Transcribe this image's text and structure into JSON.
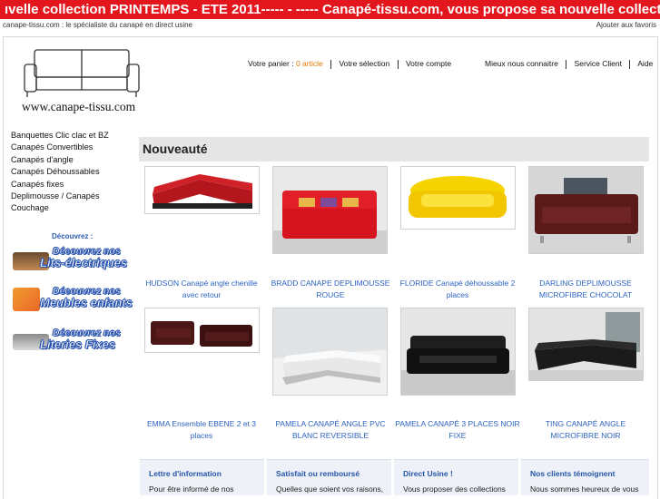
{
  "banner": {
    "text": "ıvelle collection PRINTEMPS - ETE 2011----- - ----- Canapé-tissu.com, vous propose sa nouvelle collecti"
  },
  "header": {
    "tagline": "canape-tissu.com : le spécialiste du canapé en direct usine",
    "favorites": "Ajouter aux favoris",
    "logo_text": "www.canape-tissu.com"
  },
  "nav": {
    "cart_label": "Votre panier :",
    "cart_count": "0 article",
    "selection": "Votre sélection",
    "account": "Votre compte",
    "about": "Mieux nous connaitre",
    "service": "Service Client",
    "help": "Aide"
  },
  "sidebar": {
    "items": [
      "Banquettes Clic clac et BZ",
      "Canapés Convertibles",
      "Canapés d'angle",
      "Canapés Déhoussables",
      "Canapés fixes",
      "Deplimousse / Canapés",
      "Couchage"
    ],
    "discover_label": "Découvrez :",
    "promos": [
      {
        "line1": "Découvrez nos",
        "line2": "Lits-électriques"
      },
      {
        "line1": "Découvrez nos",
        "line2": "Meubles enfants"
      },
      {
        "line1": "Découvrez nos",
        "line2": "Literies Fixes"
      }
    ]
  },
  "main": {
    "section_title": "Nouveauté",
    "products": [
      {
        "caption": "HUDSON Canapé angle chenille avec retour"
      },
      {
        "caption": "BRADD CANAPE DEPLIMOUSSE ROUGE"
      },
      {
        "caption": "FLORIDE Canapé déhoussable 2 places"
      },
      {
        "caption": "DARLING DEPLIMOUSSE MICROFIBRE CHOCOLAT"
      },
      {
        "caption": "EMMA Ensemble EBENE 2 et 3 places"
      },
      {
        "caption": "PAMELA CANAPÉ ANGLE PVC BLANC REVERSIBLE"
      },
      {
        "caption": "PAMELA CANAPÉ 3 PLACES NOIR FIXE"
      },
      {
        "caption": "TING CANAPÉ ANGLE MICROFIBRE NOIR"
      }
    ]
  },
  "info": [
    {
      "title": "Lettre d'information",
      "text": "Pour être informé de nos"
    },
    {
      "title": "Satisfait ou remboursé",
      "text": "Quelles que soient vos raisons,"
    },
    {
      "title": "Direct Usine !",
      "text": "Vous proposer des collections"
    },
    {
      "title": "Nos clients témoignent",
      "text": "Nous sommes heureux de vous"
    }
  ],
  "colors": {
    "banner": "#e3161d",
    "link": "#2d62c0",
    "accent_orange": "#e07a00"
  }
}
